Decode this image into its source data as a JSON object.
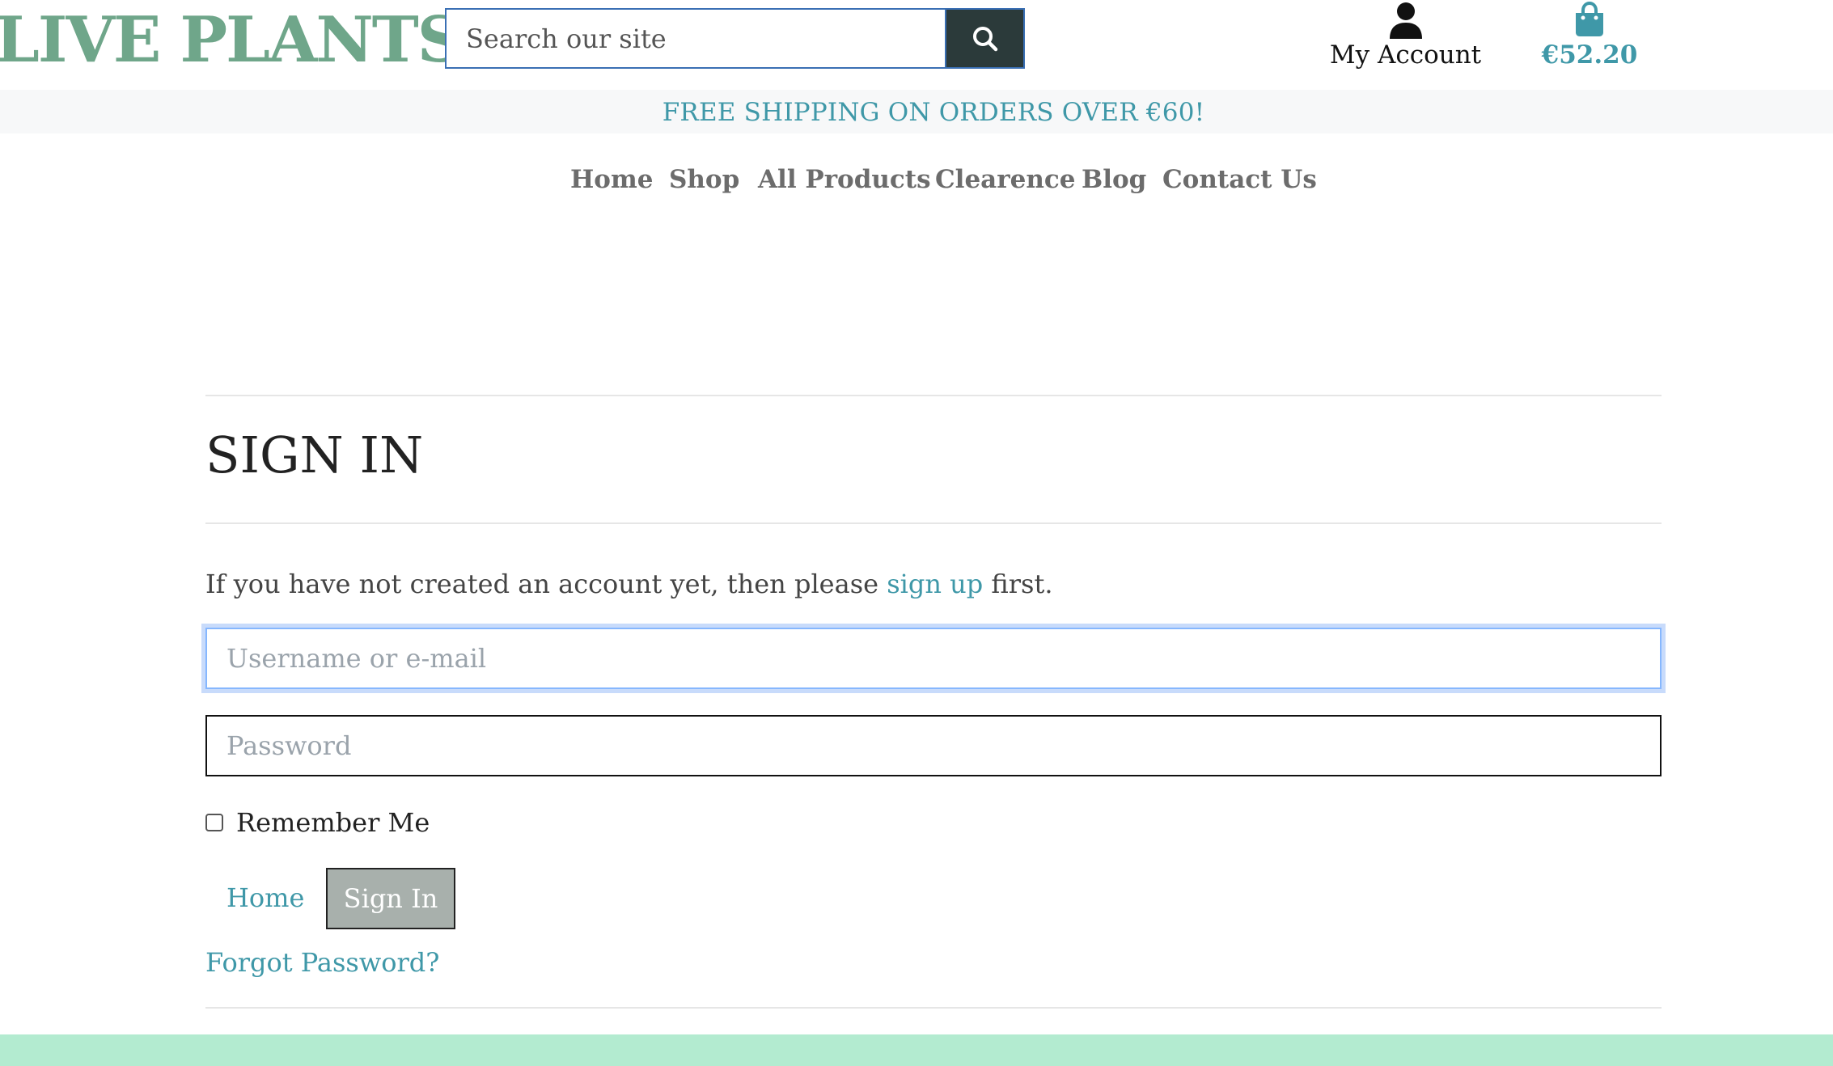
{
  "header": {
    "logo": "LIVE PLANTS",
    "search_placeholder": "Search our site",
    "search_icon": "search-icon",
    "account_label": "My Account",
    "account_icon": "user-icon",
    "cart_total": "€52.20",
    "cart_icon": "shopping-bag-icon"
  },
  "banner": {
    "text": "FREE SHIPPING ON ORDERS OVER €60!"
  },
  "nav": {
    "items": [
      "Home",
      "Shop",
      "All Products",
      "Clearence",
      "Blog",
      "Contact Us"
    ]
  },
  "signin": {
    "title": "SIGN IN",
    "intro_before": "If you have not created an account yet, then please ",
    "intro_link": "sign up",
    "intro_after": " first.",
    "username_placeholder": "Username or e-mail",
    "password_placeholder": "Password",
    "remember_label": "Remember Me",
    "home_link": "Home",
    "signin_button": "Sign In",
    "forgot_link": "Forgot Password?"
  },
  "colors": {
    "brand_green": "#6fa68a",
    "accent_teal": "#3f98a8",
    "search_button_bg": "#2b3a3a",
    "footer_mint": "#b3ebd0",
    "signin_button_bg": "#a8b0ac"
  }
}
